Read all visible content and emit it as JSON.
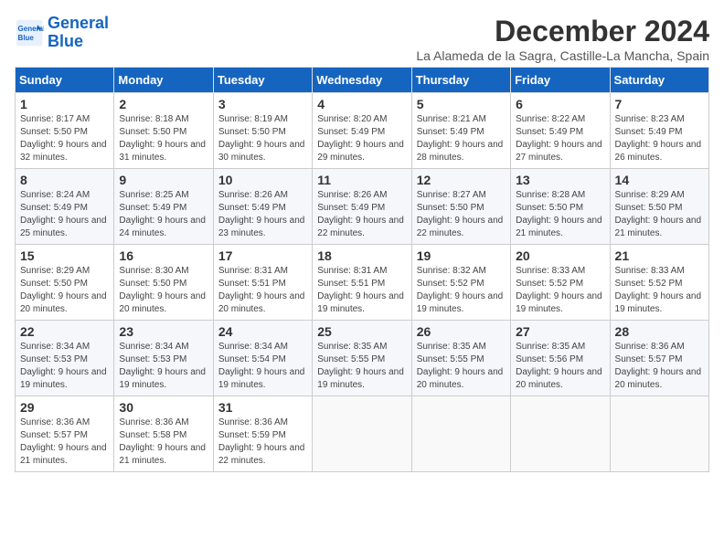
{
  "logo": {
    "line1": "General",
    "line2": "Blue"
  },
  "title": "December 2024",
  "subtitle": "La Alameda de la Sagra, Castille-La Mancha, Spain",
  "weekdays": [
    "Sunday",
    "Monday",
    "Tuesday",
    "Wednesday",
    "Thursday",
    "Friday",
    "Saturday"
  ],
  "weeks": [
    [
      {
        "day": "1",
        "sunrise": "8:17 AM",
        "sunset": "5:50 PM",
        "daylight": "9 hours and 32 minutes."
      },
      {
        "day": "2",
        "sunrise": "8:18 AM",
        "sunset": "5:50 PM",
        "daylight": "9 hours and 31 minutes."
      },
      {
        "day": "3",
        "sunrise": "8:19 AM",
        "sunset": "5:50 PM",
        "daylight": "9 hours and 30 minutes."
      },
      {
        "day": "4",
        "sunrise": "8:20 AM",
        "sunset": "5:49 PM",
        "daylight": "9 hours and 29 minutes."
      },
      {
        "day": "5",
        "sunrise": "8:21 AM",
        "sunset": "5:49 PM",
        "daylight": "9 hours and 28 minutes."
      },
      {
        "day": "6",
        "sunrise": "8:22 AM",
        "sunset": "5:49 PM",
        "daylight": "9 hours and 27 minutes."
      },
      {
        "day": "7",
        "sunrise": "8:23 AM",
        "sunset": "5:49 PM",
        "daylight": "9 hours and 26 minutes."
      }
    ],
    [
      {
        "day": "8",
        "sunrise": "8:24 AM",
        "sunset": "5:49 PM",
        "daylight": "9 hours and 25 minutes."
      },
      {
        "day": "9",
        "sunrise": "8:25 AM",
        "sunset": "5:49 PM",
        "daylight": "9 hours and 24 minutes."
      },
      {
        "day": "10",
        "sunrise": "8:26 AM",
        "sunset": "5:49 PM",
        "daylight": "9 hours and 23 minutes."
      },
      {
        "day": "11",
        "sunrise": "8:26 AM",
        "sunset": "5:49 PM",
        "daylight": "9 hours and 22 minutes."
      },
      {
        "day": "12",
        "sunrise": "8:27 AM",
        "sunset": "5:50 PM",
        "daylight": "9 hours and 22 minutes."
      },
      {
        "day": "13",
        "sunrise": "8:28 AM",
        "sunset": "5:50 PM",
        "daylight": "9 hours and 21 minutes."
      },
      {
        "day": "14",
        "sunrise": "8:29 AM",
        "sunset": "5:50 PM",
        "daylight": "9 hours and 21 minutes."
      }
    ],
    [
      {
        "day": "15",
        "sunrise": "8:29 AM",
        "sunset": "5:50 PM",
        "daylight": "9 hours and 20 minutes."
      },
      {
        "day": "16",
        "sunrise": "8:30 AM",
        "sunset": "5:50 PM",
        "daylight": "9 hours and 20 minutes."
      },
      {
        "day": "17",
        "sunrise": "8:31 AM",
        "sunset": "5:51 PM",
        "daylight": "9 hours and 20 minutes."
      },
      {
        "day": "18",
        "sunrise": "8:31 AM",
        "sunset": "5:51 PM",
        "daylight": "9 hours and 19 minutes."
      },
      {
        "day": "19",
        "sunrise": "8:32 AM",
        "sunset": "5:52 PM",
        "daylight": "9 hours and 19 minutes."
      },
      {
        "day": "20",
        "sunrise": "8:33 AM",
        "sunset": "5:52 PM",
        "daylight": "9 hours and 19 minutes."
      },
      {
        "day": "21",
        "sunrise": "8:33 AM",
        "sunset": "5:52 PM",
        "daylight": "9 hours and 19 minutes."
      }
    ],
    [
      {
        "day": "22",
        "sunrise": "8:34 AM",
        "sunset": "5:53 PM",
        "daylight": "9 hours and 19 minutes."
      },
      {
        "day": "23",
        "sunrise": "8:34 AM",
        "sunset": "5:53 PM",
        "daylight": "9 hours and 19 minutes."
      },
      {
        "day": "24",
        "sunrise": "8:34 AM",
        "sunset": "5:54 PM",
        "daylight": "9 hours and 19 minutes."
      },
      {
        "day": "25",
        "sunrise": "8:35 AM",
        "sunset": "5:55 PM",
        "daylight": "9 hours and 19 minutes."
      },
      {
        "day": "26",
        "sunrise": "8:35 AM",
        "sunset": "5:55 PM",
        "daylight": "9 hours and 20 minutes."
      },
      {
        "day": "27",
        "sunrise": "8:35 AM",
        "sunset": "5:56 PM",
        "daylight": "9 hours and 20 minutes."
      },
      {
        "day": "28",
        "sunrise": "8:36 AM",
        "sunset": "5:57 PM",
        "daylight": "9 hours and 20 minutes."
      }
    ],
    [
      {
        "day": "29",
        "sunrise": "8:36 AM",
        "sunset": "5:57 PM",
        "daylight": "9 hours and 21 minutes."
      },
      {
        "day": "30",
        "sunrise": "8:36 AM",
        "sunset": "5:58 PM",
        "daylight": "9 hours and 21 minutes."
      },
      {
        "day": "31",
        "sunrise": "8:36 AM",
        "sunset": "5:59 PM",
        "daylight": "9 hours and 22 minutes."
      },
      null,
      null,
      null,
      null
    ]
  ]
}
